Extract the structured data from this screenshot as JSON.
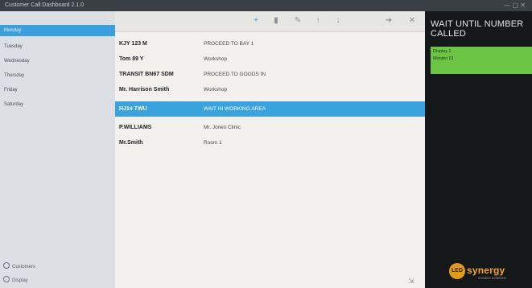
{
  "window": {
    "title": "Customer Call Dashboard 2.1.0",
    "controls": "— ▢ ✕"
  },
  "sidebar": {
    "items": [
      {
        "label": "Monday",
        "active": true
      },
      {
        "label": "Tuesday",
        "active": false
      },
      {
        "label": "Wednesday",
        "active": false
      },
      {
        "label": "Thursday",
        "active": false
      },
      {
        "label": "Friday",
        "active": false
      },
      {
        "label": "Saturday",
        "active": false
      }
    ],
    "footer": [
      {
        "label": "Customers"
      },
      {
        "label": "Display"
      }
    ]
  },
  "toolbar": {
    "icons": [
      "plus-icon",
      "trash-icon",
      "edit-icon",
      "arrow-up-icon",
      "arrow-down-icon",
      "send-icon",
      "close-icon"
    ]
  },
  "rows": [
    {
      "name": "KJY 123 M",
      "status": "PROCEED TO BAY 1",
      "selected": false
    },
    {
      "name": "Tom 89 Y",
      "status": "Workshop",
      "selected": false
    },
    {
      "name": "TRANSIT BN67 SDM",
      "status": "PROCEED TO GOODS IN",
      "selected": false
    },
    {
      "name": "Mr. Harrison Smith",
      "status": "Workshop",
      "selected": false
    },
    {
      "name": "HJ14 TWU",
      "status": "WAIT IN WORKING AREA",
      "selected": true
    },
    {
      "name": "P.WILLIAMS",
      "status": "Mr. Jones Clinic",
      "selected": false
    },
    {
      "name": "Mr.Smith",
      "status": "Room 1",
      "selected": false
    }
  ],
  "display_panel": {
    "heading": "WAIT UNTIL NUMBER CALLED",
    "green_line1": "Display 1",
    "green_line2": "Monitor 01",
    "accent_color": "#6cc445"
  },
  "brand": {
    "badge": "LED",
    "word": "synergy",
    "tag": "creative solutions"
  }
}
